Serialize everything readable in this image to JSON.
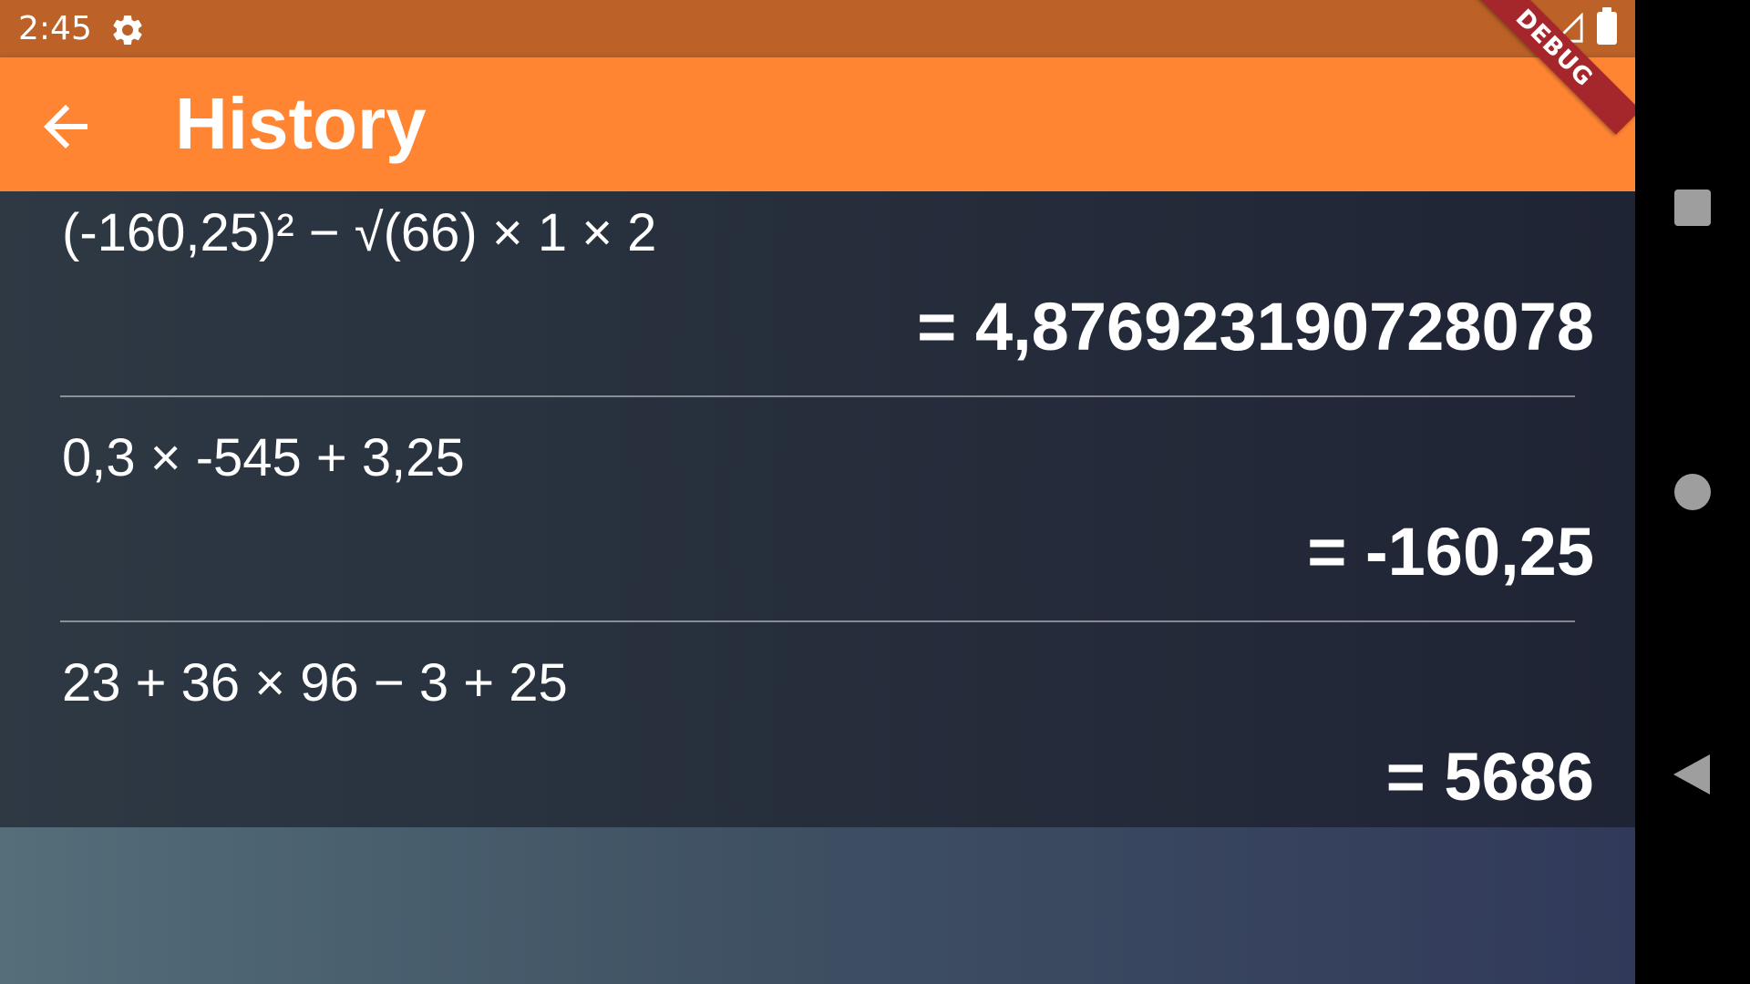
{
  "status_bar": {
    "time": "2:45",
    "icons": [
      "gear-icon",
      "wifi-icon",
      "signal-icon",
      "battery-icon"
    ]
  },
  "app_bar": {
    "title": "History",
    "back_icon": "arrow-left-icon",
    "color": "#ff8533"
  },
  "debug_banner": "DEBUG",
  "history": [
    {
      "expression": "(-160,25)² − √(66) × 1 × 2",
      "result": "= 4,876923190728078"
    },
    {
      "expression": "0,3 × -545 + 3,25",
      "result": "= -160,25"
    },
    {
      "expression": "23 + 36 × 96 − 3 + 25",
      "result": "= 5686"
    }
  ],
  "nav_bar": {
    "icons": [
      "recents-square-icon",
      "home-circle-icon",
      "back-triangle-icon"
    ]
  },
  "colors": {
    "status_bar": "#bc6127",
    "app_bar": "#ff8533",
    "debug_banner": "#a5262b",
    "list_background": "#262e3c"
  }
}
